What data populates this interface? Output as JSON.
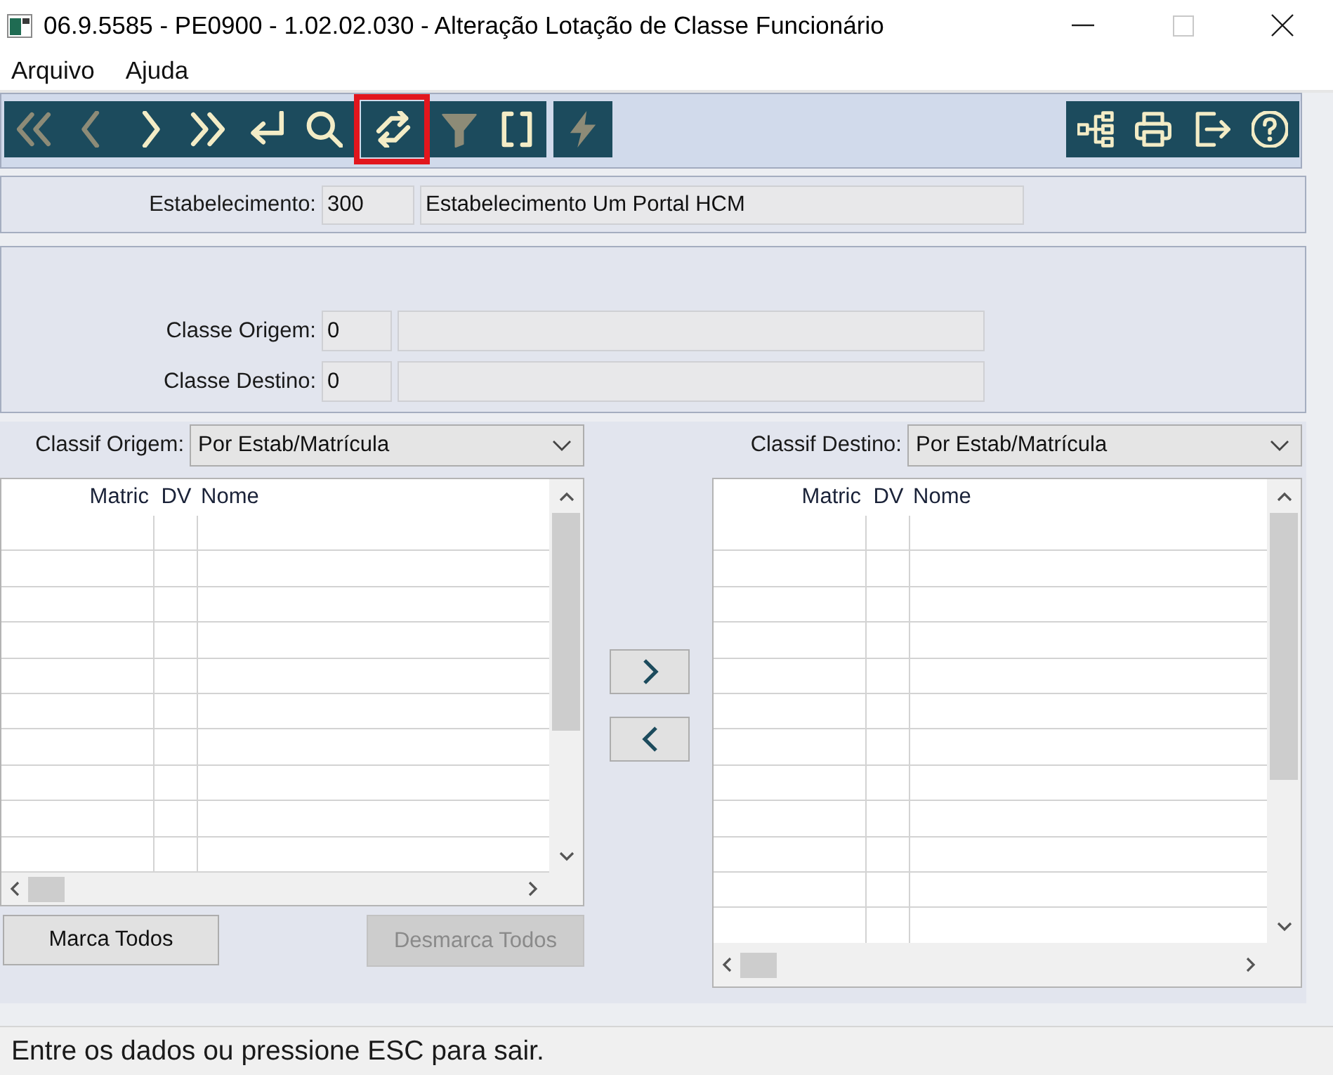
{
  "window": {
    "title": "06.9.5585 - PE0900 - 1.02.02.030 - Alteração Lotação de Classe Funcionário",
    "controls": [
      {
        "kind": "minimize",
        "disabled": false
      },
      {
        "kind": "maximize",
        "disabled": true
      },
      {
        "kind": "close",
        "disabled": false
      }
    ]
  },
  "menu": [
    {
      "label": "Arquivo"
    },
    {
      "label": "Ajuda"
    }
  ],
  "toolbar": {
    "left_groups": [
      {
        "items": [
          {
            "kind": "first",
            "disabled": true,
            "highlighted": false
          },
          {
            "kind": "previous",
            "disabled": true,
            "highlighted": false
          },
          {
            "kind": "next",
            "disabled": false,
            "highlighted": false
          },
          {
            "kind": "last",
            "disabled": false,
            "highlighted": false
          },
          {
            "kind": "enter",
            "disabled": false,
            "highlighted": false
          },
          {
            "kind": "search",
            "disabled": false,
            "highlighted": false
          }
        ]
      },
      {
        "items": [
          {
            "kind": "swap",
            "disabled": false,
            "highlighted": true
          },
          {
            "kind": "filter",
            "disabled": true,
            "highlighted": false
          },
          {
            "kind": "brackets",
            "disabled": false,
            "highlighted": false
          }
        ]
      },
      {
        "items": [
          {
            "kind": "lightning",
            "disabled": true,
            "highlighted": false
          }
        ]
      }
    ],
    "right_groups": [
      {
        "items": [
          {
            "kind": "tree",
            "disabled": false,
            "highlighted": false
          },
          {
            "kind": "print",
            "disabled": false,
            "highlighted": false
          },
          {
            "kind": "exit",
            "disabled": false,
            "highlighted": false
          },
          {
            "kind": "help",
            "disabled": false,
            "highlighted": false
          }
        ]
      }
    ]
  },
  "establishment": {
    "label": "Estabelecimento:",
    "code": "300",
    "name": "Estabelecimento Um Portal HCM"
  },
  "classes": [
    {
      "label": "Classe Origem:",
      "code": "0"
    },
    {
      "label": "Classe Destino:",
      "code": "0"
    }
  ],
  "lists": [
    {
      "sort_label": "Classif Origem:",
      "sort_value": "Por Estab/Matrícula",
      "columns": [
        "Matric",
        "DV",
        "Nome"
      ],
      "buttons": [
        {
          "label": "Marca Todos",
          "disabled": false
        },
        {
          "label": "Desmarca Todos",
          "disabled": true
        }
      ]
    },
    {
      "sort_label": "Classif Destino:",
      "sort_value": "Por Estab/Matrícula",
      "columns": [
        "Matric",
        "DV",
        "Nome"
      ]
    }
  ],
  "transfer_buttons": [
    {
      "kind": "right"
    },
    {
      "kind": "left"
    }
  ],
  "status_bar": {
    "text": "Entre os dados ou pressione ESC para sair."
  }
}
